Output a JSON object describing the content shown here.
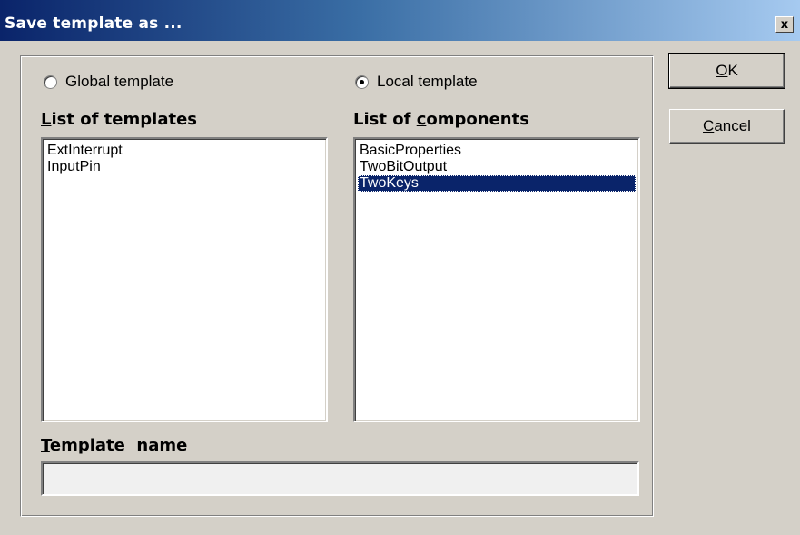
{
  "window": {
    "title": "Save template as ...",
    "close_glyph": "x"
  },
  "options": {
    "global_label": "Global template",
    "global_checked": false,
    "local_label": "Local template",
    "local_checked": true
  },
  "templates": {
    "label_accel": "L",
    "label_rest": "ist of templates",
    "items": [
      "ExtInterrupt",
      "InputPin"
    ]
  },
  "components": {
    "label_pre": "List of ",
    "label_accel": "c",
    "label_post": "omponents",
    "items": [
      "BasicProperties",
      "TwoBitOutput",
      "TwoKeys"
    ],
    "selected_index": 2
  },
  "template_name": {
    "label_accel": "T",
    "label_rest": "emplate  name",
    "value": ""
  },
  "buttons": {
    "ok_accel": "O",
    "ok_rest": "K",
    "cancel_accel": "C",
    "cancel_rest": "ancel"
  }
}
